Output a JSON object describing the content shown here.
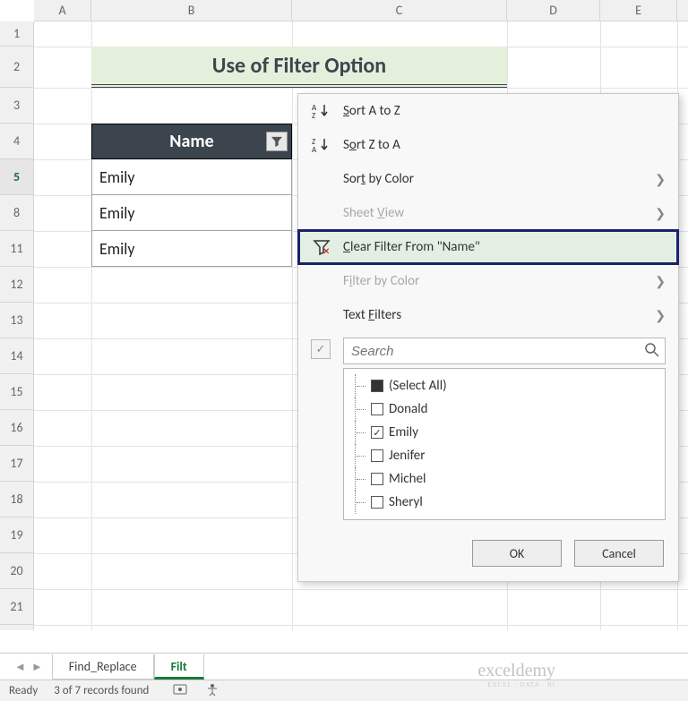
{
  "columns": [
    "A",
    "B",
    "C",
    "D",
    "E"
  ],
  "rows": [
    "1",
    "2",
    "3",
    "4",
    "5",
    "8",
    "11",
    "12",
    "13",
    "14",
    "15",
    "16",
    "17",
    "18",
    "19",
    "20",
    "21"
  ],
  "selected_row": "5",
  "title": "Use of Filter Option",
  "table": {
    "header": "Name",
    "values": [
      "Emily",
      "Emily",
      "Emily"
    ]
  },
  "menu": {
    "sort_az": "Sort A to Z",
    "sort_za": "Sort Z to A",
    "sort_color": "Sort by Color",
    "sheet_view": "Sheet View",
    "clear_filter": "Clear Filter From \"Name\"",
    "filter_color": "Filter by Color",
    "text_filters": "Text Filters",
    "search_placeholder": "Search",
    "items": [
      {
        "label": "(Select All)",
        "state": "indet"
      },
      {
        "label": "Donald",
        "state": "off"
      },
      {
        "label": "Emily",
        "state": "on"
      },
      {
        "label": "Jenifer",
        "state": "off"
      },
      {
        "label": "Michel",
        "state": "off"
      },
      {
        "label": "Sheryl",
        "state": "off"
      }
    ],
    "ok": "OK",
    "cancel": "Cancel"
  },
  "tabs": {
    "prev": "Find_Replace",
    "active": "Filt"
  },
  "status": {
    "state": "Ready",
    "records": "3 of 7 records found"
  },
  "watermark": {
    "brand": "exceldemy",
    "sub": "EXCEL · DATA · BI"
  }
}
